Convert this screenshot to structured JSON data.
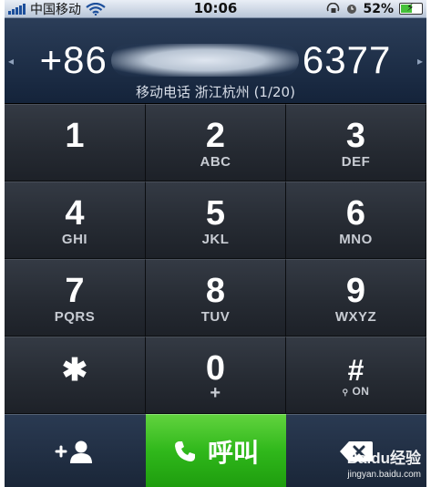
{
  "status_bar": {
    "carrier": "中国移动",
    "time": "10:06",
    "battery": "52%",
    "battery_level": 0.52,
    "icons": [
      "signal-icon",
      "wifi-icon",
      "rotation-lock-icon",
      "alarm-icon",
      "battery-icon"
    ]
  },
  "display": {
    "number_prefix": "+86",
    "number_suffix": "6377",
    "location": "移动电话 浙江杭州 (1/20)"
  },
  "keypad": {
    "keys": [
      {
        "digit": "1",
        "letters": ""
      },
      {
        "digit": "2",
        "letters": "ABC"
      },
      {
        "digit": "3",
        "letters": "DEF"
      },
      {
        "digit": "4",
        "letters": "GHI"
      },
      {
        "digit": "5",
        "letters": "JKL"
      },
      {
        "digit": "6",
        "letters": "MNO"
      },
      {
        "digit": "7",
        "letters": "PQRS"
      },
      {
        "digit": "8",
        "letters": "TUV"
      },
      {
        "digit": "9",
        "letters": "WXYZ"
      },
      {
        "digit": "✱",
        "letters": ""
      },
      {
        "digit": "0",
        "letters": "+"
      },
      {
        "digit": "#",
        "letters": "ON"
      }
    ]
  },
  "bottom_bar": {
    "call_label": "呼叫",
    "watermark_logo": "Baidu经验",
    "watermark_url": "jingyan.baidu.com"
  },
  "colors": {
    "call_green": "#30b81b",
    "display_blue": "#1f3049",
    "key_dark": "#262b33"
  }
}
